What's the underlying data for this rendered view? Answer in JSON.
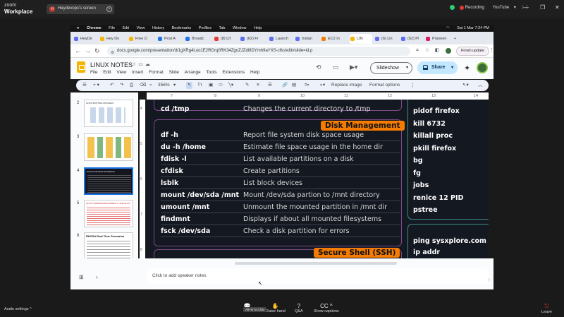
{
  "zoom": {
    "logo_top": "zoom",
    "logo_bottom": "Workplace",
    "share_avatar": "H",
    "share_label": "Heydevops's screen",
    "recording": "Recording",
    "youtube": "YouTube",
    "bottom": {
      "audio": "Audio settings",
      "chat": "Chat",
      "raise_hand": "Raise hand",
      "qa": "Q&A",
      "captions": "Show captions",
      "leave": "Leave",
      "tooltip": "Alt+H to Chat"
    }
  },
  "macbar": {
    "apple": "",
    "items": [
      "Chrome",
      "File",
      "Edit",
      "View",
      "History",
      "Bookmarks",
      "Profiles",
      "Tab",
      "Window",
      "Help"
    ],
    "datetime": "Sat 1 Mar  7:24 PM"
  },
  "tabs": [
    {
      "label": "HeyDe",
      "color": "#5f6cf4"
    },
    {
      "label": "Hey Do",
      "color": "#f4b400"
    },
    {
      "label": "Free D",
      "color": "#f4b400"
    },
    {
      "label": "Post A",
      "color": "#1a73e8"
    },
    {
      "label": "Broadc",
      "color": "#1a73e8"
    },
    {
      "label": "(8) Lif",
      "color": "#e53935"
    },
    {
      "label": "(62) Fr",
      "color": "#5f6cf4"
    },
    {
      "label": "Launch",
      "color": "#5f6cf4"
    },
    {
      "label": "Instan",
      "color": "#5f6cf4"
    },
    {
      "label": "EC2 In",
      "color": "#f57c00"
    },
    {
      "label": "LIN",
      "color": "#f4b400"
    },
    {
      "label": "(6) Lin",
      "color": "#5f6cf4"
    },
    {
      "label": "(62) Pl",
      "color": "#5f6cf4"
    },
    {
      "label": "Praveen",
      "color": "#d81b60"
    }
  ],
  "url": "docs.google.com/presentation/d/1gXRg4Luo1E2RGrq0RK34ZgoZJZdl8DYmh9aYXS-c6c/edit#slide=id.p",
  "finish_update": "Finish update",
  "docs": {
    "title": "LINUX NOTES",
    "menus": [
      "File",
      "Edit",
      "View",
      "Insert",
      "Format",
      "Slide",
      "Arrange",
      "Tools",
      "Extensions",
      "Help"
    ],
    "slideshow": "Slideshow",
    "share": "Share"
  },
  "toolbar": {
    "menu_icon": "☰",
    "zoom": "356%",
    "replace_image": "Replace image",
    "format_options": "Format options"
  },
  "ruler": [
    "7",
    "8",
    "9",
    "10",
    "11",
    "12",
    "13",
    "14"
  ],
  "vruler": [
    "4",
    "5",
    "6",
    "7",
    "8"
  ],
  "thumbs": [
    {
      "num": "2",
      "title": "LINUX BOOTING PROCESS"
    },
    {
      "num": "3",
      "title": ""
    },
    {
      "num": "4",
      "title": "Linux Commands Cheatsheet"
    },
    {
      "num": "5",
      "title": "LINUX COMMANDS/FOLDERS 17 AND PLUS"
    },
    {
      "num": "6",
      "title": "RHCSA Real Time Scenarios"
    }
  ],
  "slide": {
    "top_cmd": "cd /tmp",
    "top_desc": "Changes the current directory to /tmp",
    "section": "Disk Management",
    "section2": "Secure Shell (SSH)",
    "rows": [
      {
        "cmd": "df -h",
        "desc": "Report file system disk space usage"
      },
      {
        "cmd": "du -h /home",
        "desc": "Estimate file space usage in the home dir"
      },
      {
        "cmd": "fdisk -l",
        "desc": "List available partitions on a disk"
      },
      {
        "cmd": "cfdisk",
        "desc": "Create partitions"
      },
      {
        "cmd": "lsblk",
        "desc": "List block devices"
      },
      {
        "cmd": "mount /dev/sda /mnt",
        "desc": "Mount /dev/sda partion to /mnt directory"
      },
      {
        "cmd": "umount /mnt",
        "desc": "Unmount the mounted partition in /mnt dir"
      },
      {
        "cmd": "findmnt",
        "desc": "Displays if about all mounted filesystems"
      },
      {
        "cmd": "fsck  /dev/sda",
        "desc": "Check a disk partition for errors"
      }
    ],
    "right": [
      "pidof firefox",
      "kill 6732",
      "killall  proc",
      "pkill firefox",
      "bg",
      "fg",
      "jobs",
      "renice 12 PID",
      "pstree"
    ],
    "right2": [
      "ping sysxplore.com",
      "ip addr"
    ]
  },
  "notes_placeholder": "Click to add speaker notes"
}
